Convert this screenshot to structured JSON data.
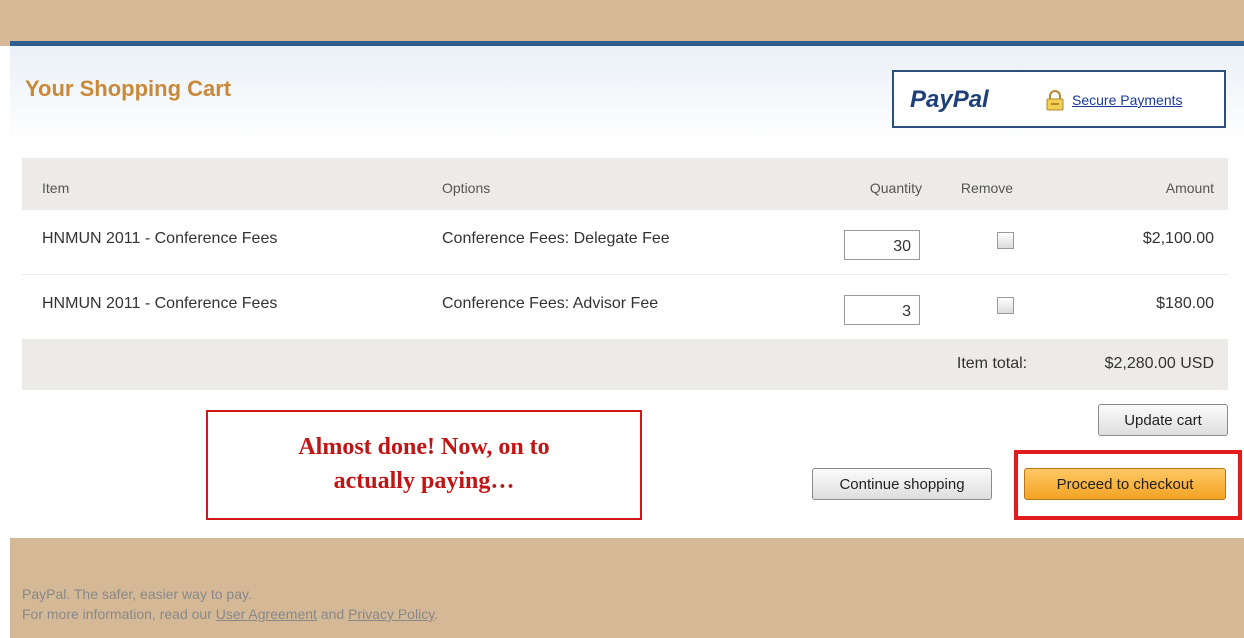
{
  "header": {
    "title": "Your Shopping Cart",
    "paypal_logo": "PayPal",
    "secure_link": "Secure Payments",
    "icon": "lock-icon"
  },
  "table": {
    "headers": {
      "item": "Item",
      "options": "Options",
      "quantity": "Quantity",
      "remove": "Remove",
      "amount": "Amount"
    },
    "rows": [
      {
        "item": "HNMUN 2011 - Conference Fees",
        "options": "Conference Fees: Delegate Fee",
        "quantity": "30",
        "amount": "$2,100.00"
      },
      {
        "item": "HNMUN 2011 - Conference Fees",
        "options": "Conference Fees: Advisor Fee",
        "quantity": "3",
        "amount": "$180.00"
      }
    ],
    "total_label": "Item total:",
    "total_amount": "$2,280.00 USD"
  },
  "buttons": {
    "update": "Update cart",
    "continue": "Continue shopping",
    "checkout": "Proceed to checkout"
  },
  "annotation": {
    "line1": "Almost done! Now, on to",
    "line2": "actually paying…"
  },
  "footer": {
    "tagline": "PayPal. The safer, easier way to pay.",
    "info_prefix": "For more information, read our",
    "user_agreement": "User Agreement",
    "and": "and",
    "privacy_policy": "Privacy Policy",
    "period": "."
  },
  "colors": {
    "band": "#d5b997",
    "title": "#c88a3a",
    "checkout": "#f2a323",
    "highlight": "#e21c1c"
  }
}
